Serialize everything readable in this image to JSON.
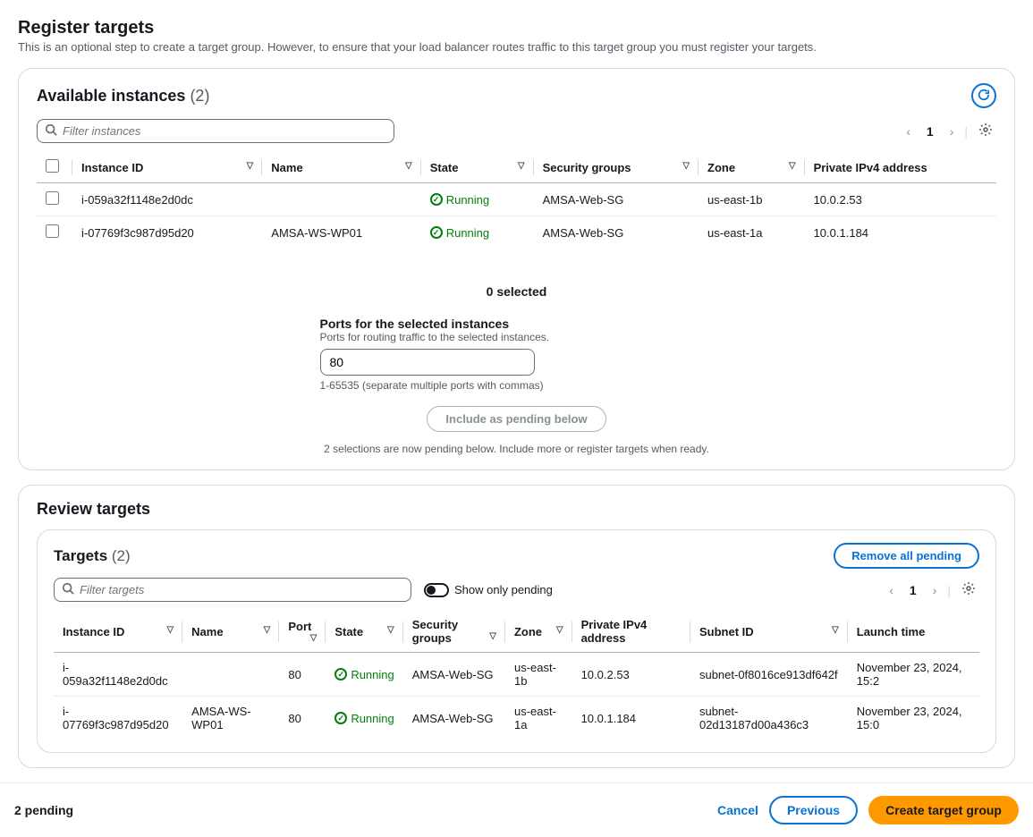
{
  "page": {
    "title": "Register targets",
    "subtitle": "This is an optional step to create a target group. However, to ensure that your load balancer routes traffic to this target group you must register your targets."
  },
  "available": {
    "title": "Available instances",
    "count": "(2)",
    "search_placeholder": "Filter instances",
    "page": "1",
    "columns": {
      "instance_id": "Instance ID",
      "name": "Name",
      "state": "State",
      "security_groups": "Security groups",
      "zone": "Zone",
      "private_ip": "Private IPv4 address"
    },
    "rows": [
      {
        "id": "i-059a32f1148e2d0dc",
        "name": "",
        "state": "Running",
        "sg": "AMSA-Web-SG",
        "zone": "us-east-1b",
        "ip": "10.0.2.53"
      },
      {
        "id": "i-07769f3c987d95d20",
        "name": "AMSA-WS-WP01",
        "state": "Running",
        "sg": "AMSA-Web-SG",
        "zone": "us-east-1a",
        "ip": "10.0.1.184"
      }
    ]
  },
  "selection": {
    "selected_text": "0 selected",
    "ports_label": "Ports for the selected instances",
    "ports_desc": "Ports for routing traffic to the selected instances.",
    "ports_value": "80",
    "ports_hint": "1-65535 (separate multiple ports with commas)",
    "include_btn": "Include as pending below",
    "pending_msg": "2 selections are now pending below. Include more or register targets when ready."
  },
  "review": {
    "title": "Review targets",
    "targets_title": "Targets",
    "targets_count": "(2)",
    "remove_btn": "Remove all pending",
    "search_placeholder": "Filter targets",
    "toggle_label": "Show only pending",
    "page": "1",
    "columns": {
      "instance_id": "Instance ID",
      "name": "Name",
      "port": "Port",
      "state": "State",
      "security_groups": "Security groups",
      "zone": "Zone",
      "private_ip": "Private IPv4 address",
      "subnet_id": "Subnet ID",
      "launch_time": "Launch time"
    },
    "rows": [
      {
        "id": "i-059a32f1148e2d0dc",
        "name": "",
        "port": "80",
        "state": "Running",
        "sg": "AMSA-Web-SG",
        "zone": "us-east-1b",
        "ip": "10.0.2.53",
        "subnet": "subnet-0f8016ce913df642f",
        "launch": "November 23, 2024, 15:2"
      },
      {
        "id": "i-07769f3c987d95d20",
        "name": "AMSA-WS-WP01",
        "port": "80",
        "state": "Running",
        "sg": "AMSA-Web-SG",
        "zone": "us-east-1a",
        "ip": "10.0.1.184",
        "subnet": "subnet-02d13187d00a436c3",
        "launch": "November 23, 2024, 15:0"
      }
    ]
  },
  "footer": {
    "pending": "2 pending",
    "cancel": "Cancel",
    "previous": "Previous",
    "create": "Create target group"
  }
}
